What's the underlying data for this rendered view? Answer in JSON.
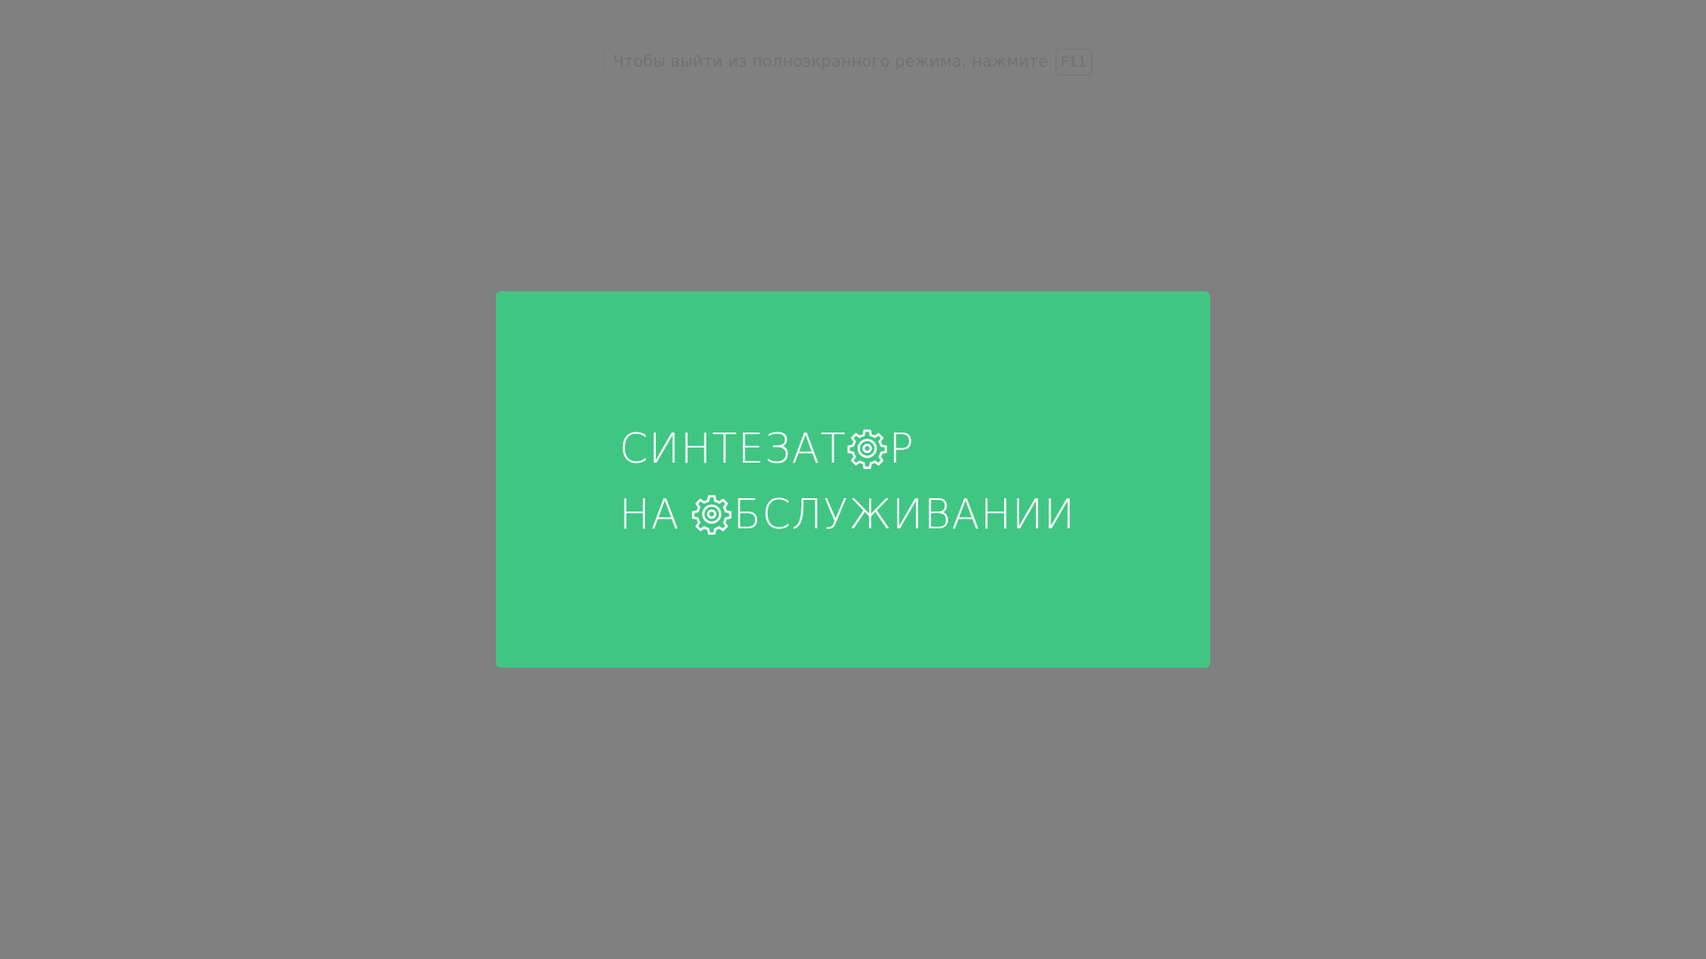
{
  "fullscreen_hint": {
    "text": "Чтобы выйти из полноэкранного режима, нажмите",
    "key": "F11"
  },
  "maintenance": {
    "line1_part1": "СИНТЕЗАТ",
    "line1_part2": "Р",
    "line2_part1": "НА",
    "line2_part2": "БСЛУЖИВАНИИ",
    "gear_icon": "gear-icon",
    "background_color": "#40c682",
    "text_color": "#ffffff"
  },
  "page": {
    "background_color": "#808080"
  }
}
